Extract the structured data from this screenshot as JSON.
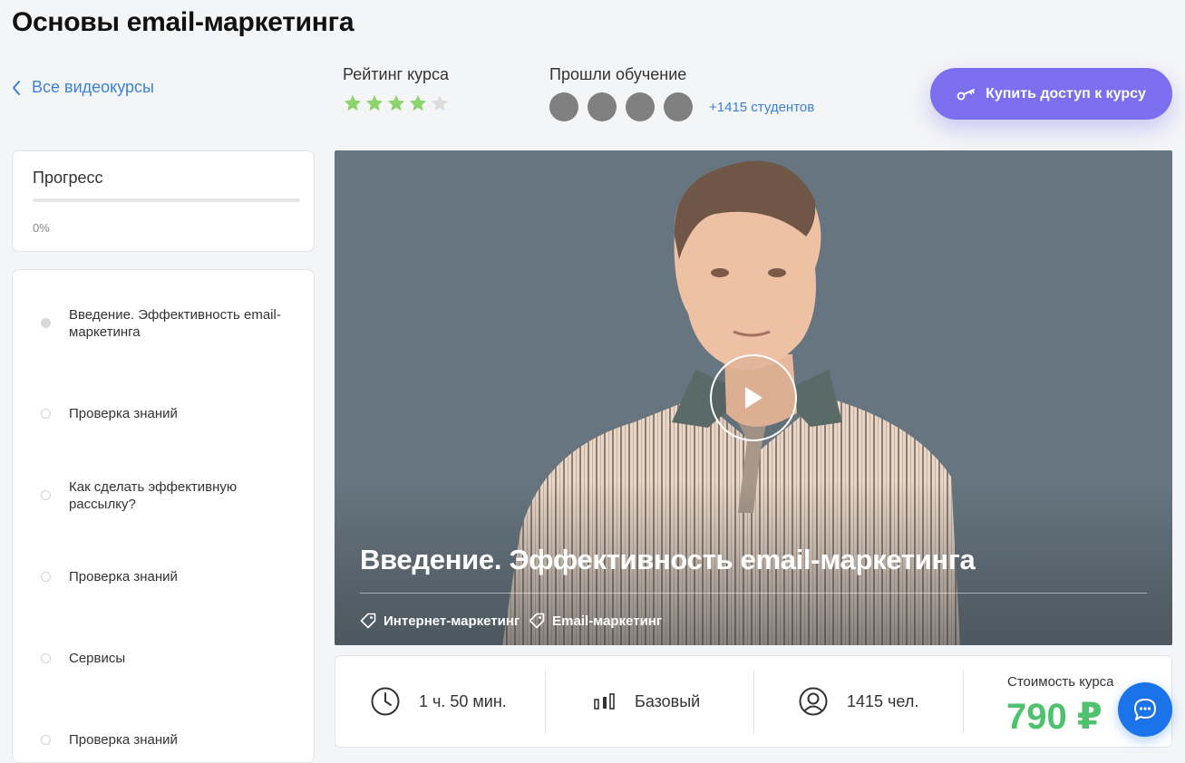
{
  "page": {
    "title": "Основы email-маркетинга"
  },
  "nav": {
    "back_label": "Все видеокурсы"
  },
  "rating": {
    "label": "Рейтинг курса",
    "value": 4,
    "max": 5,
    "star_color": "#8bd36a",
    "empty_star_color": "#dcdcdc"
  },
  "students": {
    "label": "Прошли обучение",
    "avatars_shown": 4,
    "count_text": "+1415 студентов"
  },
  "buy": {
    "label": "Купить доступ к курсу",
    "icon": "key-icon",
    "color": "#7b6ff0"
  },
  "progress": {
    "title": "Прогресс",
    "value_text": "0%",
    "value": 0
  },
  "lessons": [
    {
      "label": "Введение. Эффективность email-маркетинга",
      "active": true
    },
    {
      "label": "Проверка знаний",
      "active": false
    },
    {
      "label": "Как сделать эффективную рассылку?",
      "active": false
    },
    {
      "label": "Проверка знаний",
      "active": false
    },
    {
      "label": "Сервисы",
      "active": false
    },
    {
      "label": "Проверка знаний",
      "active": false
    }
  ],
  "video": {
    "title": "Введение. Эффективность email-маркетинга",
    "tags": [
      "Интернет-маркетинг",
      "Email-маркетинг"
    ],
    "play_icon": "play-icon"
  },
  "info": {
    "duration": "1 ч. 50 мин.",
    "level": "Базовый",
    "people": "1415 чел.",
    "price_label": "Стоимость курса",
    "price": "790 ₽",
    "price_color": "#4fc26e"
  },
  "chat": {
    "icon": "chat-icon",
    "color": "#1a73e8"
  }
}
